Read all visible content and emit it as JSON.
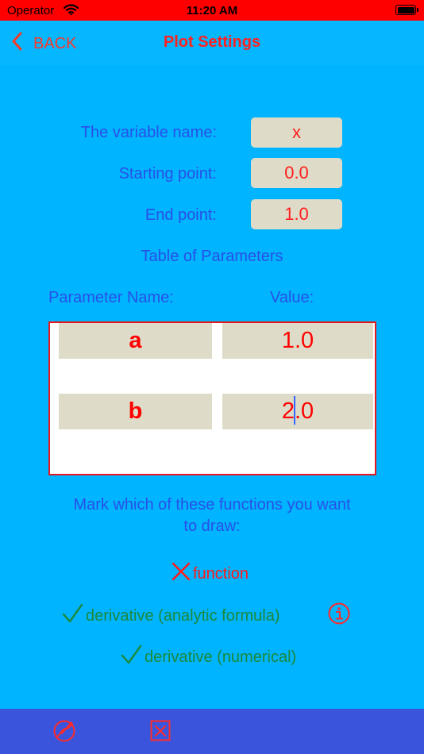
{
  "status": {
    "carrier": "Operator",
    "time": "11:20 AM"
  },
  "nav": {
    "back_label": "BACK",
    "title": "Plot Settings"
  },
  "form": {
    "variable_label": "The variable name:",
    "variable_value": "x",
    "start_label": "Starting point:",
    "start_value": "0.0",
    "end_label": "End point:",
    "end_value": "1.0"
  },
  "params": {
    "title": "Table of Parameters",
    "name_header": "Parameter Name:",
    "value_header": "Value:",
    "rows": [
      {
        "name": "a",
        "value": "1.0"
      },
      {
        "name": "b",
        "value_before_cursor": "2",
        "value_after_cursor": ".0"
      }
    ]
  },
  "functions": {
    "prompt_line1": "Mark which of these functions you want",
    "prompt_line2": "to draw:",
    "items": [
      {
        "label": "function",
        "checked": false,
        "mark_icon": "cross-icon"
      },
      {
        "label": "derivative (analytic formula)",
        "checked": true,
        "mark_icon": "checkmark-icon"
      },
      {
        "label": "derivative (numerical)",
        "checked": true,
        "mark_icon": "checkmark-icon"
      }
    ]
  },
  "colors": {
    "background": "#00b4ff",
    "status_bar": "#ff0000",
    "accent_red": "#ff1e1e",
    "label_blue": "#2850e8",
    "check_green": "#1b8a3a",
    "field_bg": "#dedcc8",
    "bottom_bar": "#3a55dc"
  },
  "icons": {
    "status": [
      "wifi-icon",
      "battery-icon"
    ],
    "nav": [
      "chevron-left-icon"
    ],
    "toolbar": [
      "plot-icon",
      "close-box-icon"
    ],
    "info": "info-icon"
  }
}
